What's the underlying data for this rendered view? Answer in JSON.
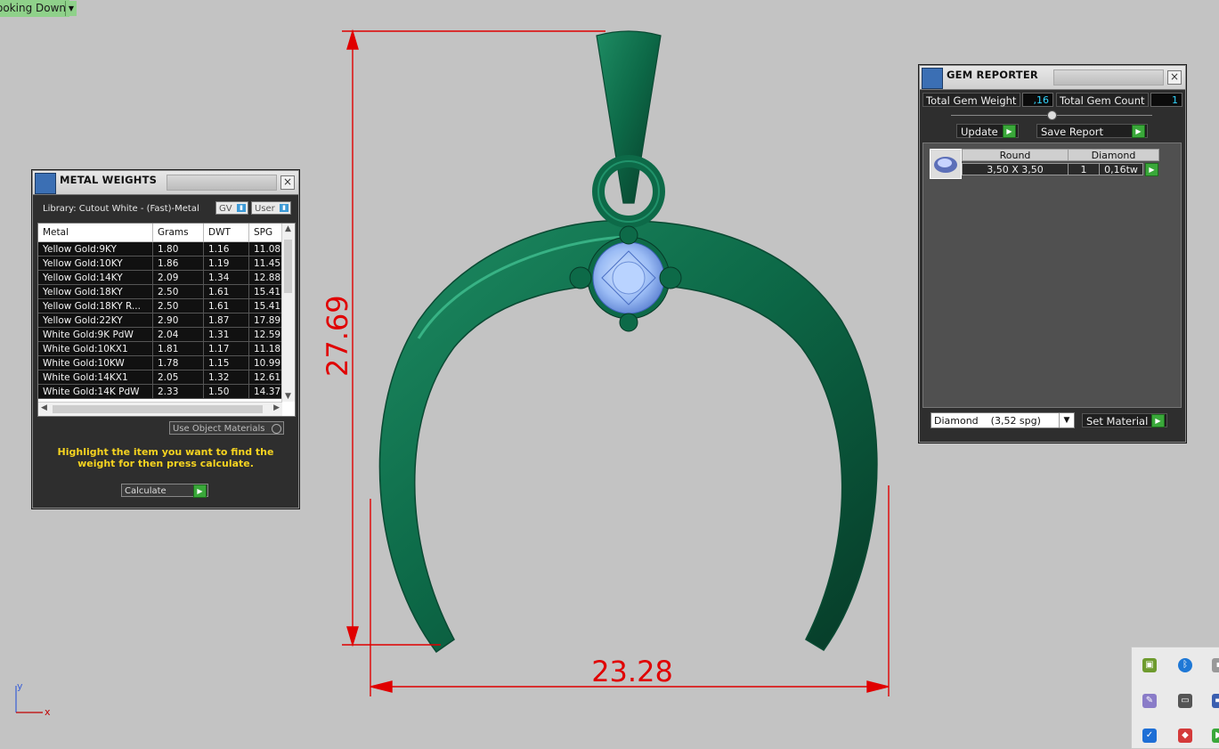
{
  "viewport": {
    "label": "ooking Down"
  },
  "dimensions": {
    "height": "27.69",
    "width": "23.28"
  },
  "axis": {
    "x": "x",
    "y": "y"
  },
  "metal_weights": {
    "title": "METAL WEIGHTS",
    "library": "Library: Cutout White - (Fast)-Metal",
    "toggle_gv": "GV",
    "toggle_user": "User",
    "columns": [
      "Metal",
      "Grams",
      "DWT",
      "SPG"
    ],
    "rows": [
      [
        "Yellow Gold:9KY",
        "1.80",
        "1.16",
        "11.08"
      ],
      [
        "Yellow Gold:10KY",
        "1.86",
        "1.19",
        "11.45"
      ],
      [
        "Yellow Gold:14KY",
        "2.09",
        "1.34",
        "12.88"
      ],
      [
        "Yellow Gold:18KY",
        "2.50",
        "1.61",
        "15.41"
      ],
      [
        "Yellow Gold:18KY R...",
        "2.50",
        "1.61",
        "15.41"
      ],
      [
        "Yellow Gold:22KY",
        "2.90",
        "1.87",
        "17.89"
      ],
      [
        "White Gold:9K PdW",
        "2.04",
        "1.31",
        "12.59"
      ],
      [
        "White Gold:10KX1",
        "1.81",
        "1.17",
        "11.18"
      ],
      [
        "White Gold:10KW",
        "1.78",
        "1.15",
        "10.99"
      ],
      [
        "White Gold:14KX1",
        "2.05",
        "1.32",
        "12.61"
      ],
      [
        "White Gold:14K PdW",
        "2.33",
        "1.50",
        "14.37"
      ]
    ],
    "use_object_materials": "Use Object Materials",
    "hint": "Highlight the item you want to find the weight for then press calculate.",
    "calculate": "Calculate"
  },
  "gem_reporter": {
    "title": "GEM REPORTER",
    "total_weight_label": "Total Gem Weight",
    "total_weight_value": ",16",
    "total_count_label": "Total Gem Count",
    "total_count_value": "1",
    "update": "Update",
    "save_report": "Save Report",
    "gem_header_shape": "Round",
    "gem_header_type": "Diamond",
    "gem_size": "3,50 X 3,50",
    "gem_qty": "1",
    "gem_tw": "0,16tw",
    "material_select": "Diamond    (3,52 spg)",
    "set_material": "Set Material"
  },
  "colors": {
    "metal": "#0f6b4b",
    "dimension": "#e00000",
    "gem": "#9cc4ff",
    "hint": "#f5d320"
  }
}
